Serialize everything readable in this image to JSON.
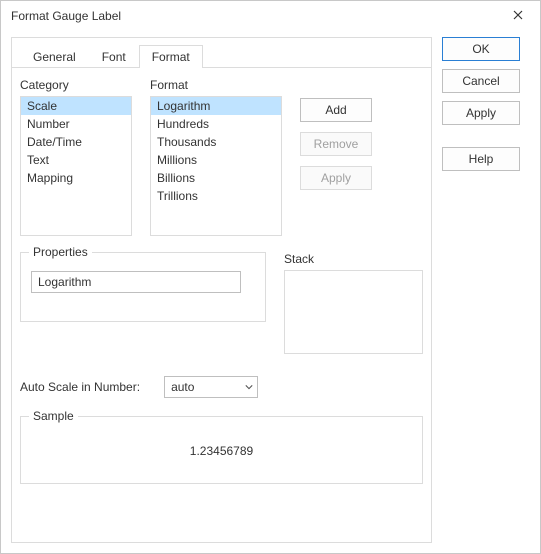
{
  "window": {
    "title": "Format Gauge Label"
  },
  "tabs": {
    "general": "General",
    "font": "Font",
    "format": "Format"
  },
  "labels": {
    "category": "Category",
    "format": "Format",
    "properties": "Properties",
    "stack": "Stack",
    "autoscale": "Auto Scale in Number:",
    "sample": "Sample"
  },
  "category_items": [
    "Scale",
    "Number",
    "Date/Time",
    "Text",
    "Mapping"
  ],
  "format_items": [
    "Logarithm",
    "Hundreds",
    "Thousands",
    "Millions",
    "Billions",
    "Trillions"
  ],
  "actions": {
    "add": "Add",
    "remove": "Remove",
    "apply": "Apply"
  },
  "properties_value": "Logarithm",
  "autoscale_value": "auto",
  "sample_value": "1.23456789",
  "dialog_buttons": {
    "ok": "OK",
    "cancel": "Cancel",
    "apply": "Apply",
    "help": "Help"
  }
}
